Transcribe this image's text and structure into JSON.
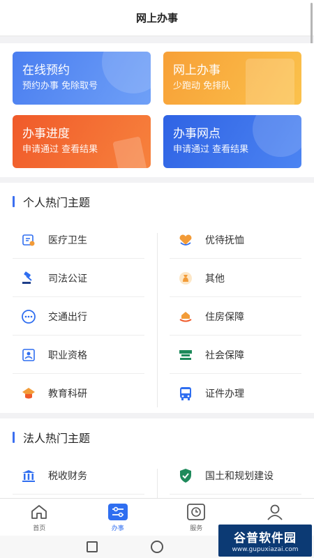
{
  "header": {
    "title": "网上办事"
  },
  "cards": [
    {
      "title": "在线预约",
      "subtitle": "预约办事 免除取号"
    },
    {
      "title": "网上办事",
      "subtitle": "少跑动 免排队"
    },
    {
      "title": "办事进度",
      "subtitle": "申请通过 查看结果"
    },
    {
      "title": "办事网点",
      "subtitle": "申请通过 查看结果"
    }
  ],
  "personal": {
    "title": "个人热门主题",
    "items": [
      {
        "label": "医疗卫生",
        "icon": "medical-icon"
      },
      {
        "label": "优待抚恤",
        "icon": "heart-hand-icon"
      },
      {
        "label": "司法公证",
        "icon": "gavel-icon"
      },
      {
        "label": "其他",
        "icon": "money-bag-icon"
      },
      {
        "label": "交通出行",
        "icon": "traffic-icon"
      },
      {
        "label": "住房保障",
        "icon": "house-hand-icon"
      },
      {
        "label": "职业资格",
        "icon": "certificate-icon"
      },
      {
        "label": "社会保障",
        "icon": "social-security-icon"
      },
      {
        "label": "教育科研",
        "icon": "education-icon"
      },
      {
        "label": "证件办理",
        "icon": "bus-icon"
      }
    ]
  },
  "legal": {
    "title": "法人热门主题",
    "items": [
      {
        "label": "税收财务",
        "icon": "tax-building-icon"
      },
      {
        "label": "国土和规划建设",
        "icon": "shield-icon"
      }
    ]
  },
  "tabs": [
    {
      "label": "首页",
      "icon": "home-icon"
    },
    {
      "label": "办事",
      "icon": "sliders-icon",
      "active": true
    },
    {
      "label": "服务",
      "icon": "clock-icon"
    },
    {
      "label": "我的",
      "icon": "user-icon"
    }
  ],
  "watermark": {
    "name": "谷普软件园",
    "url": "www.gupuxiazai.com"
  },
  "colors": {
    "accent": "#3b6ff0",
    "orange": "#f29b38",
    "green": "#1e8a5b"
  }
}
